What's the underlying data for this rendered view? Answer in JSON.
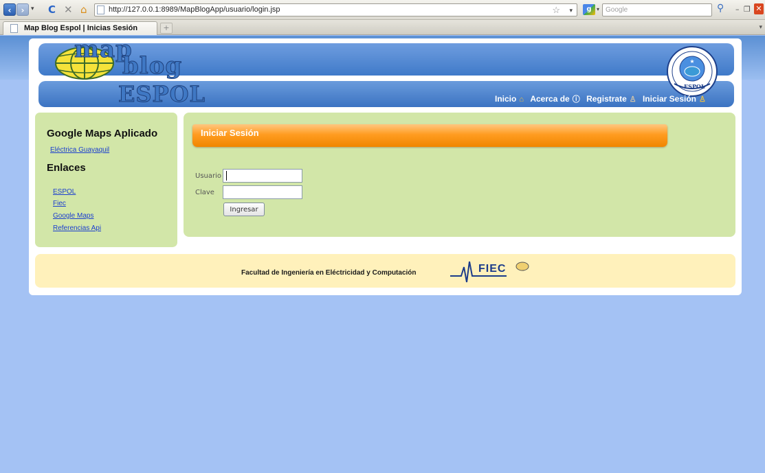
{
  "browser": {
    "url": "http://127.0.0.1:8989/MapBlogApp/usuario/login.jsp",
    "search_placeholder": "Google",
    "tab_title": "Map Blog Espol | Inicias Sesión",
    "new_tab_symbol": "+"
  },
  "header": {
    "logo_line1": "map",
    "logo_line2": "blog",
    "logo_line3": "ESPOL",
    "seal_label": "ESPOL",
    "nav": [
      {
        "label": "Inicio",
        "icon": "house-icon"
      },
      {
        "label": "Acerca de",
        "icon": "info-icon"
      },
      {
        "label": "Registrate",
        "icon": "user-icon"
      },
      {
        "label": "Iniciar Sesión",
        "icon": "key-user-icon"
      }
    ]
  },
  "sidebar": {
    "heading_maps": "Google Maps Aplicado",
    "maps_links": [
      "Eléctrica Guayaquil"
    ],
    "heading_links": "Enlaces",
    "links": [
      "ESPOL",
      "Fiec",
      "Google Maps",
      "Referencias Api"
    ]
  },
  "login": {
    "title": "Iniciar Sesión",
    "user_label": "Usuario",
    "user_value": "",
    "password_label": "Clave",
    "password_value": "",
    "submit_label": "Ingresar"
  },
  "footer": {
    "text": "Facultad de Ingeniería en Eléctricidad y Computación",
    "logo_text": "FIEC"
  }
}
